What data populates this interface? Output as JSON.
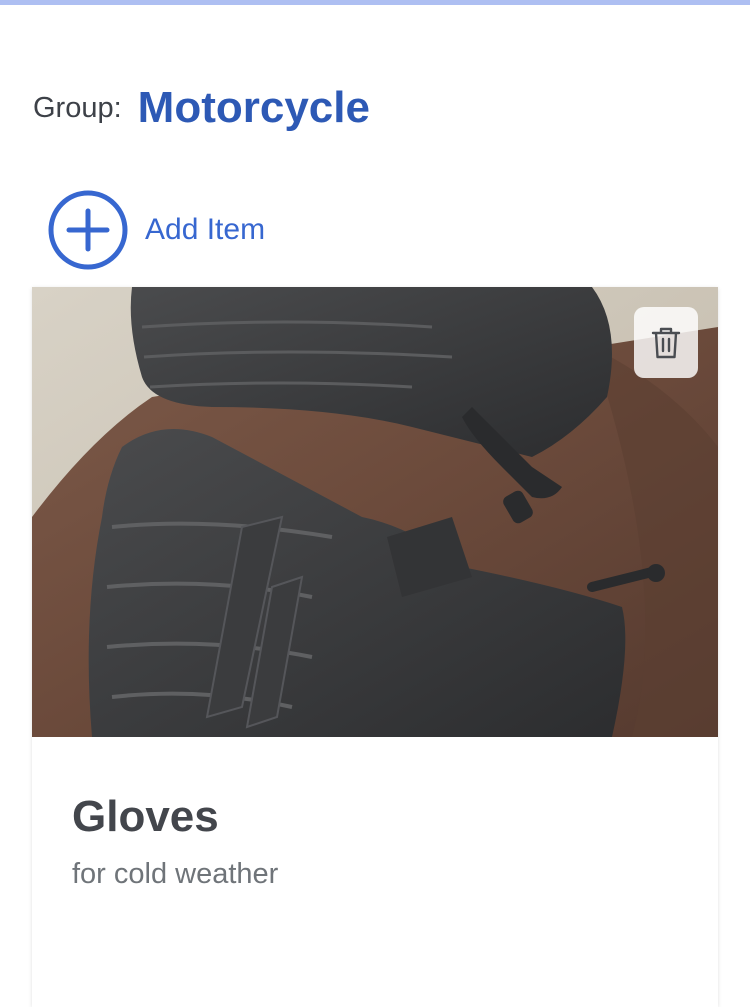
{
  "header": {
    "group_label": "Group:",
    "group_name": "Motorcycle"
  },
  "actions": {
    "add_item_label": "Add Item",
    "add_icon": "plus-circle-icon"
  },
  "items": [
    {
      "title": "Gloves",
      "description": "for cold weather",
      "image": "photo of black leather motorcycle gloves on a brown leather surface",
      "delete_icon": "trash-icon"
    }
  ],
  "colors": {
    "accent": "#2d59b5",
    "add_item": "#3767d0",
    "top_bar": "#aebff2",
    "title_text": "#43464c",
    "secondary_text": "#6f7479"
  }
}
